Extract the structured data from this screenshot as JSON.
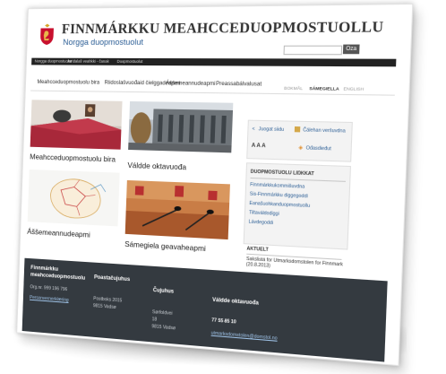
{
  "header": {
    "title": "FINNMÁRKKU MEAHCCEDUOPMOSTUOLLU",
    "subtitle": "Norgga duopmostuolut",
    "search_button": "Oza"
  },
  "top_bar": [
    "Norgga duopmostuolut",
    "Juridalaš veahkki - čanak",
    "Duopmostuolut"
  ],
  "nav": {
    "items": [
      "Meahcceduopmostuolu bira",
      "Riidoslašvuođaid čielggadeapmi",
      "Áššemeannudeapmi",
      "Preassabálvalusat"
    ],
    "languages": [
      "BOKMÅL",
      "SÁMEGIELLA",
      "ENGLISH"
    ]
  },
  "tiles": [
    {
      "caption": "Meahcceduopmostuolu bira"
    },
    {
      "caption": "Váldde oktavuođa"
    },
    {
      "caption": "Áššemeannudeapmi"
    },
    {
      "caption": "Sámegiela geavaheapmi"
    }
  ],
  "sidebar": {
    "tools": [
      "Juogat siidu",
      "Čálehan"
    ],
    "tools_second_line": "Čálehan veršuvdna",
    "font_size": "A A A",
    "rss": "Ođasdieđut",
    "links_title": "DUOPMOSTUOLU LIŊKKAT",
    "links": [
      "Finnmárkkukommišuvdna",
      "Sis-Finnmárkku diggegoddi",
      "Eanašuohkanduopmostuollu",
      "Tiltaváldodiggi",
      "Lávdegoddi"
    ],
    "news_title": "AKTUELT",
    "news_text": [
      "Sakslistá for Utmarksdomstolen for Finnmark",
      "(20.8.2013)"
    ],
    "news_more": "Oddasvuođat"
  },
  "footer": {
    "col1": {
      "title": [
        "Finnmárkku",
        "meahcceduopmostuolu"
      ],
      "org": "Org.nr. 999 196 796",
      "link": "Personvernerklæring"
    },
    "col2": {
      "title": "Poastačujuhus",
      "lines": [
        "Postboks 2015",
        "9815 Vadsø"
      ]
    },
    "col3": {
      "title": "Čujuhus",
      "lines": [
        "Sørfoldvei",
        "18",
        "9815 Vadsø"
      ]
    },
    "col4": {
      "title": "Váldde oktavuođa",
      "phone": "77 55 85 10",
      "email": "utmarksdomstolen@domstol.no"
    }
  },
  "colors": {
    "accent": "#2d5f96",
    "footer": "#343a40",
    "tile_red": "#a8283a"
  }
}
